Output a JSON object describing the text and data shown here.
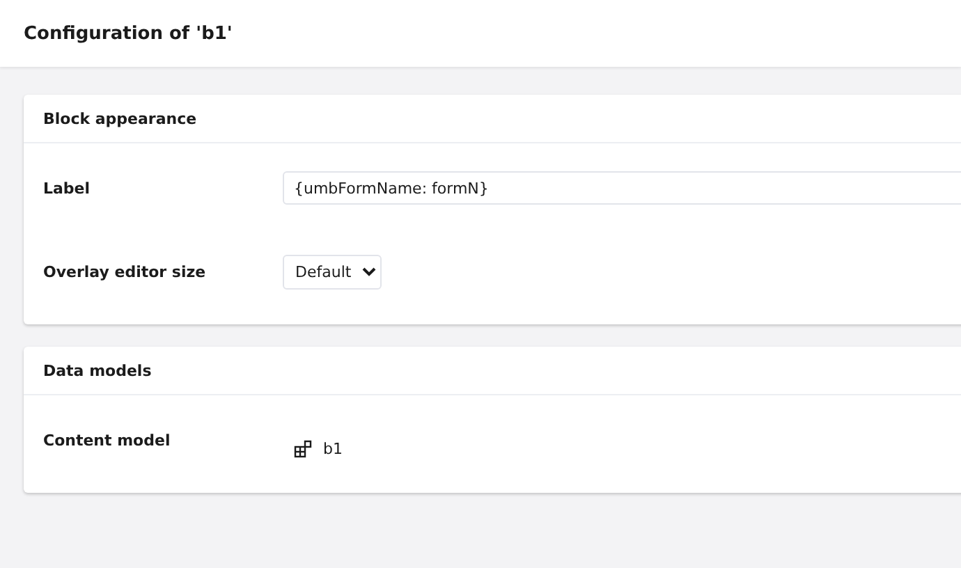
{
  "header": {
    "title": "Configuration of 'b1'"
  },
  "sections": [
    {
      "title": "Block appearance",
      "fields": [
        {
          "kind": "text",
          "label": "Label",
          "value": "{umbFormName: formN}"
        },
        {
          "kind": "select",
          "label": "Overlay editor size",
          "value": "Default"
        }
      ]
    },
    {
      "title": "Data models",
      "fields": [
        {
          "kind": "model",
          "label": "Content model",
          "value": "b1"
        }
      ]
    }
  ]
}
